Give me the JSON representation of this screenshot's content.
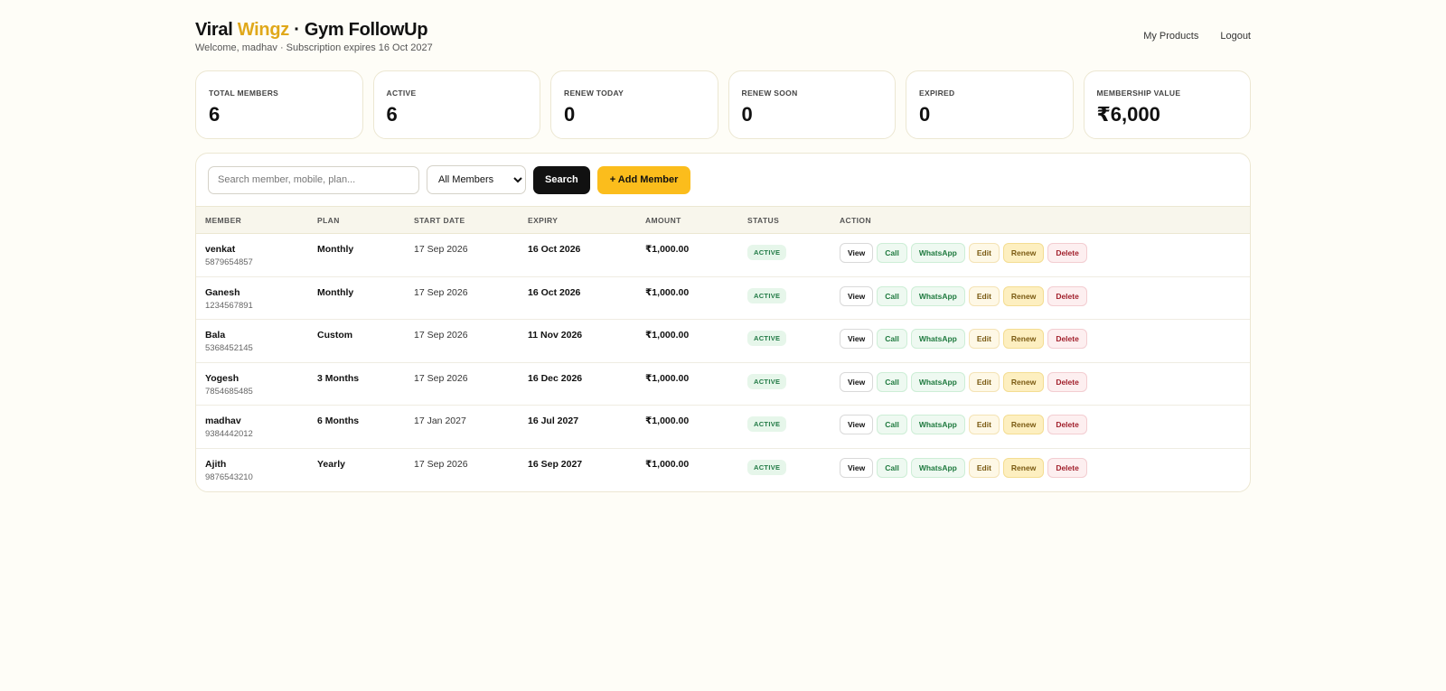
{
  "header": {
    "brand_part1": "Viral ",
    "brand_accent": "Wingz",
    "brand_part2": " · Gym FollowUp",
    "subtitle": "Welcome, madhav · Subscription expires 16 Oct 2027",
    "nav": [
      "My Products",
      "Logout"
    ]
  },
  "stats": [
    {
      "label": "TOTAL MEMBERS",
      "value": "6"
    },
    {
      "label": "ACTIVE",
      "value": "6"
    },
    {
      "label": "RENEW TODAY",
      "value": "0"
    },
    {
      "label": "RENEW SOON",
      "value": "0"
    },
    {
      "label": "EXPIRED",
      "value": "0"
    },
    {
      "label": "MEMBERSHIP VALUE",
      "value": "₹6,000"
    }
  ],
  "toolbar": {
    "search_placeholder": "Search member, mobile, plan...",
    "filter_selected": "All Members",
    "search_label": "Search",
    "add_label": "+ Add Member"
  },
  "table": {
    "columns": [
      "MEMBER",
      "PLAN",
      "START DATE",
      "EXPIRY",
      "AMOUNT",
      "STATUS",
      "ACTION"
    ],
    "actions": [
      "View",
      "Call",
      "WhatsApp",
      "Edit",
      "Renew",
      "Delete"
    ],
    "rows": [
      {
        "name": "venkat",
        "phone": "5879654857",
        "plan": "Monthly",
        "start": "17 Sep 2026",
        "expiry": "16 Oct 2026",
        "amount": "₹1,000.00",
        "status": "ACTIVE"
      },
      {
        "name": "Ganesh",
        "phone": "1234567891",
        "plan": "Monthly",
        "start": "17 Sep 2026",
        "expiry": "16 Oct 2026",
        "amount": "₹1,000.00",
        "status": "ACTIVE"
      },
      {
        "name": "Bala",
        "phone": "5368452145",
        "plan": "Custom",
        "start": "17 Sep 2026",
        "expiry": "11 Nov 2026",
        "amount": "₹1,000.00",
        "status": "ACTIVE"
      },
      {
        "name": "Yogesh",
        "phone": "7854685485",
        "plan": "3 Months",
        "start": "17 Sep 2026",
        "expiry": "16 Dec 2026",
        "amount": "₹1,000.00",
        "status": "ACTIVE"
      },
      {
        "name": "madhav",
        "phone": "9384442012",
        "plan": "6 Months",
        "start": "17 Jan 2027",
        "expiry": "16 Jul 2027",
        "amount": "₹1,000.00",
        "status": "ACTIVE"
      },
      {
        "name": "Ajith",
        "phone": "9876543210",
        "plan": "Yearly",
        "start": "17 Sep 2026",
        "expiry": "16 Sep 2027",
        "amount": "₹1,000.00",
        "status": "ACTIVE"
      }
    ]
  },
  "colors": {
    "accent": "#e0a81a",
    "add_button": "#fbbd1c",
    "background": "#fefdf7"
  }
}
